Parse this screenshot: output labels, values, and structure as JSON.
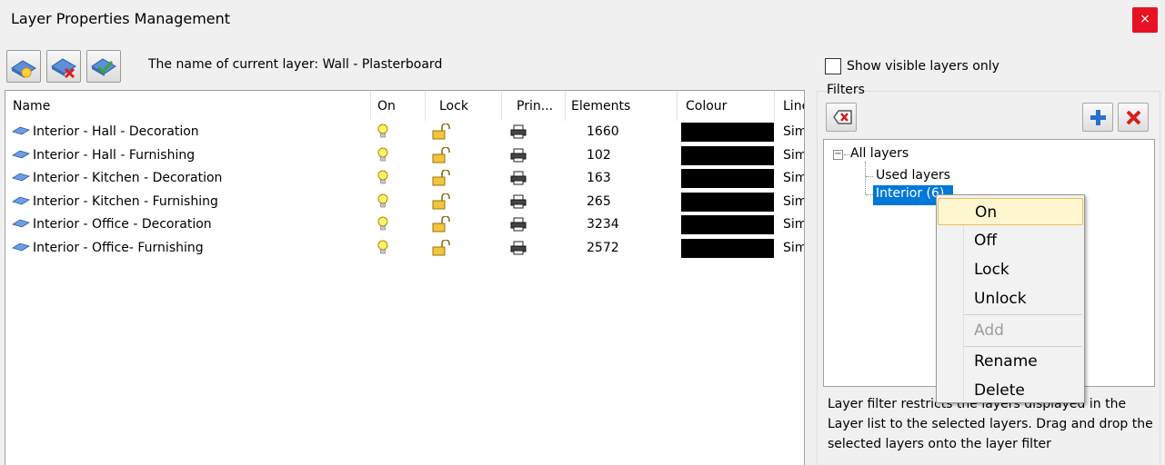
{
  "window": {
    "title": "Layer Properties Management",
    "close_label": "×"
  },
  "toolbar": {
    "current_layer_text": "The name of current layer: Wall - Plasterboard",
    "buttons": [
      "new-layer-icon",
      "delete-layer-icon",
      "set-current-layer-icon"
    ]
  },
  "table": {
    "headers": {
      "name": "Name",
      "on": "On",
      "lock": "Lock",
      "print": "Prin...",
      "elements": "Elements",
      "colour": "Colour",
      "linetype": "Line"
    },
    "rows": [
      {
        "name": "Interior - Hall - Decoration",
        "elements": "1660",
        "colour": "#000000",
        "linetype": "Sim"
      },
      {
        "name": "Interior - Hall - Furnishing",
        "elements": "102",
        "colour": "#000000",
        "linetype": "Sim"
      },
      {
        "name": "Interior - Kitchen - Decoration",
        "elements": "163",
        "colour": "#000000",
        "linetype": "Sim"
      },
      {
        "name": "Interior - Kitchen - Furnishing",
        "elements": "265",
        "colour": "#000000",
        "linetype": "Sim"
      },
      {
        "name": "Interior - Office - Decoration",
        "elements": "3234",
        "colour": "#000000",
        "linetype": "Sim"
      },
      {
        "name": "Interior - Office- Furnishing",
        "elements": "2572",
        "colour": "#000000",
        "linetype": "Sim"
      }
    ]
  },
  "right_panel": {
    "show_visible_label": "Show visible layers only",
    "show_visible_checked": false,
    "filters_label": "Filters",
    "tree": {
      "root": "All layers",
      "children": [
        "Used layers",
        "Interior (6)"
      ],
      "selected": "Interior (6)"
    },
    "help_text": "Layer filter restricts the layers displayed in the Layer list to the selected layers. Drag and drop the selected layers onto the layer filter"
  },
  "context_menu": {
    "items": [
      {
        "label": "On",
        "highlighted": true,
        "enabled": true
      },
      {
        "label": "Off",
        "enabled": true
      },
      {
        "label": "Lock",
        "enabled": true
      },
      {
        "label": "Unlock",
        "enabled": true
      },
      {
        "label": "Add",
        "enabled": false
      },
      {
        "label": "Rename",
        "enabled": true
      },
      {
        "label": "Delete",
        "enabled": true
      }
    ]
  },
  "colors": {
    "selection": "#0078d7",
    "close_button": "#e81123",
    "menu_highlight": "#fef6cf"
  }
}
